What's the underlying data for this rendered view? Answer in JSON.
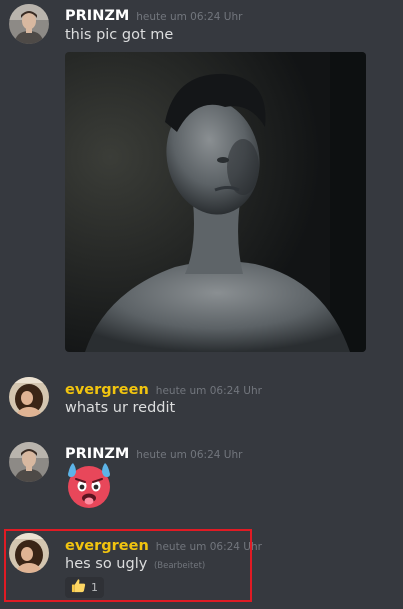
{
  "messages": [
    {
      "author": "PRINZM",
      "timestamp": "heute um 06:24 Uhr",
      "text": "this pic got me",
      "attachment": "photo"
    },
    {
      "author": "evergreen",
      "timestamp": "heute um 06:24 Uhr",
      "text": "whats ur reddit"
    },
    {
      "author": "PRINZM",
      "timestamp": "heute um 06:24 Uhr",
      "emoji": "hot-face-emoji"
    },
    {
      "author": "evergreen",
      "timestamp": "heute um 06:24 Uhr",
      "text": "hes so ugly",
      "edited_label": "(Bearbeitet)",
      "reaction": {
        "icon": "thumbs-up-icon",
        "count": "1"
      }
    }
  ],
  "colors": {
    "background": "#36393f",
    "username_default": "#ffffff",
    "username_evergreen": "#f1c40f",
    "timestamp": "#72767d",
    "highlight_border": "#e01b24"
  }
}
